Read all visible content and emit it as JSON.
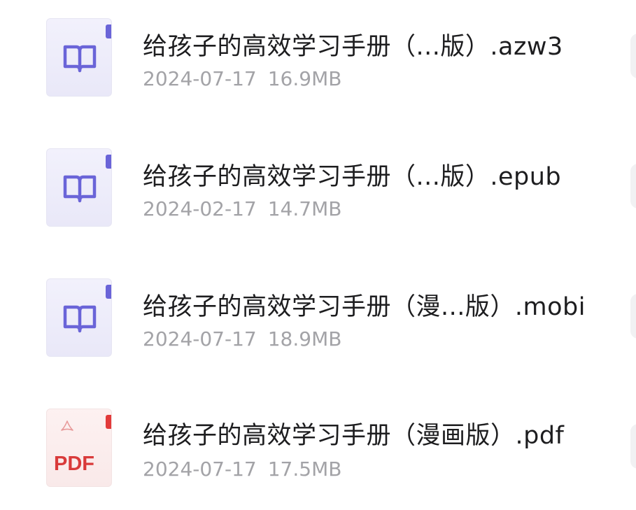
{
  "files": [
    {
      "name": "给孩子的高效学习手册（...版）.azw3",
      "date": "2024-07-17",
      "size": "16.9MB",
      "icon": "ebook-icon"
    },
    {
      "name": "给孩子的高效学习手册（...版）.epub",
      "date": "2024-02-17",
      "size": "14.7MB",
      "icon": "ebook-icon"
    },
    {
      "name": "给孩子的高效学习手册（漫...版）.mobi",
      "date": "2024-07-17",
      "size": "18.9MB",
      "icon": "ebook-icon"
    },
    {
      "name": "给孩子的高效学习手册（漫画版）.pdf",
      "date": "2024-07-17",
      "size": "17.5MB",
      "icon": "pdf-icon",
      "icon_label": "PDF"
    }
  ],
  "colors": {
    "ebook_accent": "#6a64d8",
    "pdf_accent": "#e23b3b",
    "title_text": "#1d1d1f",
    "meta_text": "#a3a3a7"
  }
}
